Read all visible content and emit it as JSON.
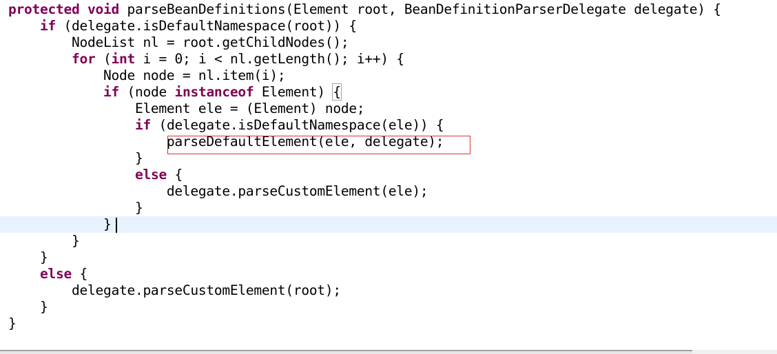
{
  "editor": {
    "language": "java",
    "keyword_color": "#7f0055",
    "current_line": 13,
    "highlight_box_color": "#e03030",
    "lines": [
      [
        {
          "k": 1,
          "t": "protected"
        },
        {
          "t": " "
        },
        {
          "k": 1,
          "t": "void"
        },
        {
          "t": " parseBeanDefinitions(Element root, BeanDefinitionParserDelegate delegate) {"
        }
      ],
      [
        {
          "t": "    "
        },
        {
          "k": 1,
          "t": "if"
        },
        {
          "t": " (delegate.isDefaultNamespace(root)) {"
        }
      ],
      [
        {
          "t": "        NodeList nl = root.getChildNodes();"
        }
      ],
      [
        {
          "t": "        "
        },
        {
          "k": 1,
          "t": "for"
        },
        {
          "t": " ("
        },
        {
          "k": 1,
          "t": "int"
        },
        {
          "t": " i = 0; i < nl.getLength(); i++) {"
        }
      ],
      [
        {
          "t": "            Node node = nl.item(i);"
        }
      ],
      [
        {
          "t": "            "
        },
        {
          "k": 1,
          "t": "if"
        },
        {
          "t": " (node "
        },
        {
          "k": 1,
          "t": "instanceof"
        },
        {
          "t": " Element) "
        },
        {
          "m": 1,
          "t": "{"
        }
      ],
      [
        {
          "t": "                Element ele = (Element) node;"
        }
      ],
      [
        {
          "t": "                "
        },
        {
          "k": 1,
          "t": "if"
        },
        {
          "t": " (delegate.isDefaultNamespace(ele)) {"
        }
      ],
      [
        {
          "t": "                    parseDefaultElement(ele, delegate);"
        }
      ],
      [
        {
          "t": "                }"
        }
      ],
      [
        {
          "t": "                "
        },
        {
          "k": 1,
          "t": "else"
        },
        {
          "t": " {"
        }
      ],
      [
        {
          "t": "                    delegate.parseCustomElement(ele);"
        }
      ],
      [
        {
          "t": "                }"
        }
      ],
      [
        {
          "t": "            }"
        }
      ],
      [
        {
          "t": "        }"
        }
      ],
      [
        {
          "t": "    }"
        }
      ],
      [
        {
          "t": "    "
        },
        {
          "k": 1,
          "t": "else"
        },
        {
          "t": " {"
        }
      ],
      [
        {
          "t": "        delegate.parseCustomElement(root);"
        }
      ],
      [
        {
          "t": "    }"
        }
      ],
      [
        {
          "t": "}"
        }
      ]
    ]
  }
}
